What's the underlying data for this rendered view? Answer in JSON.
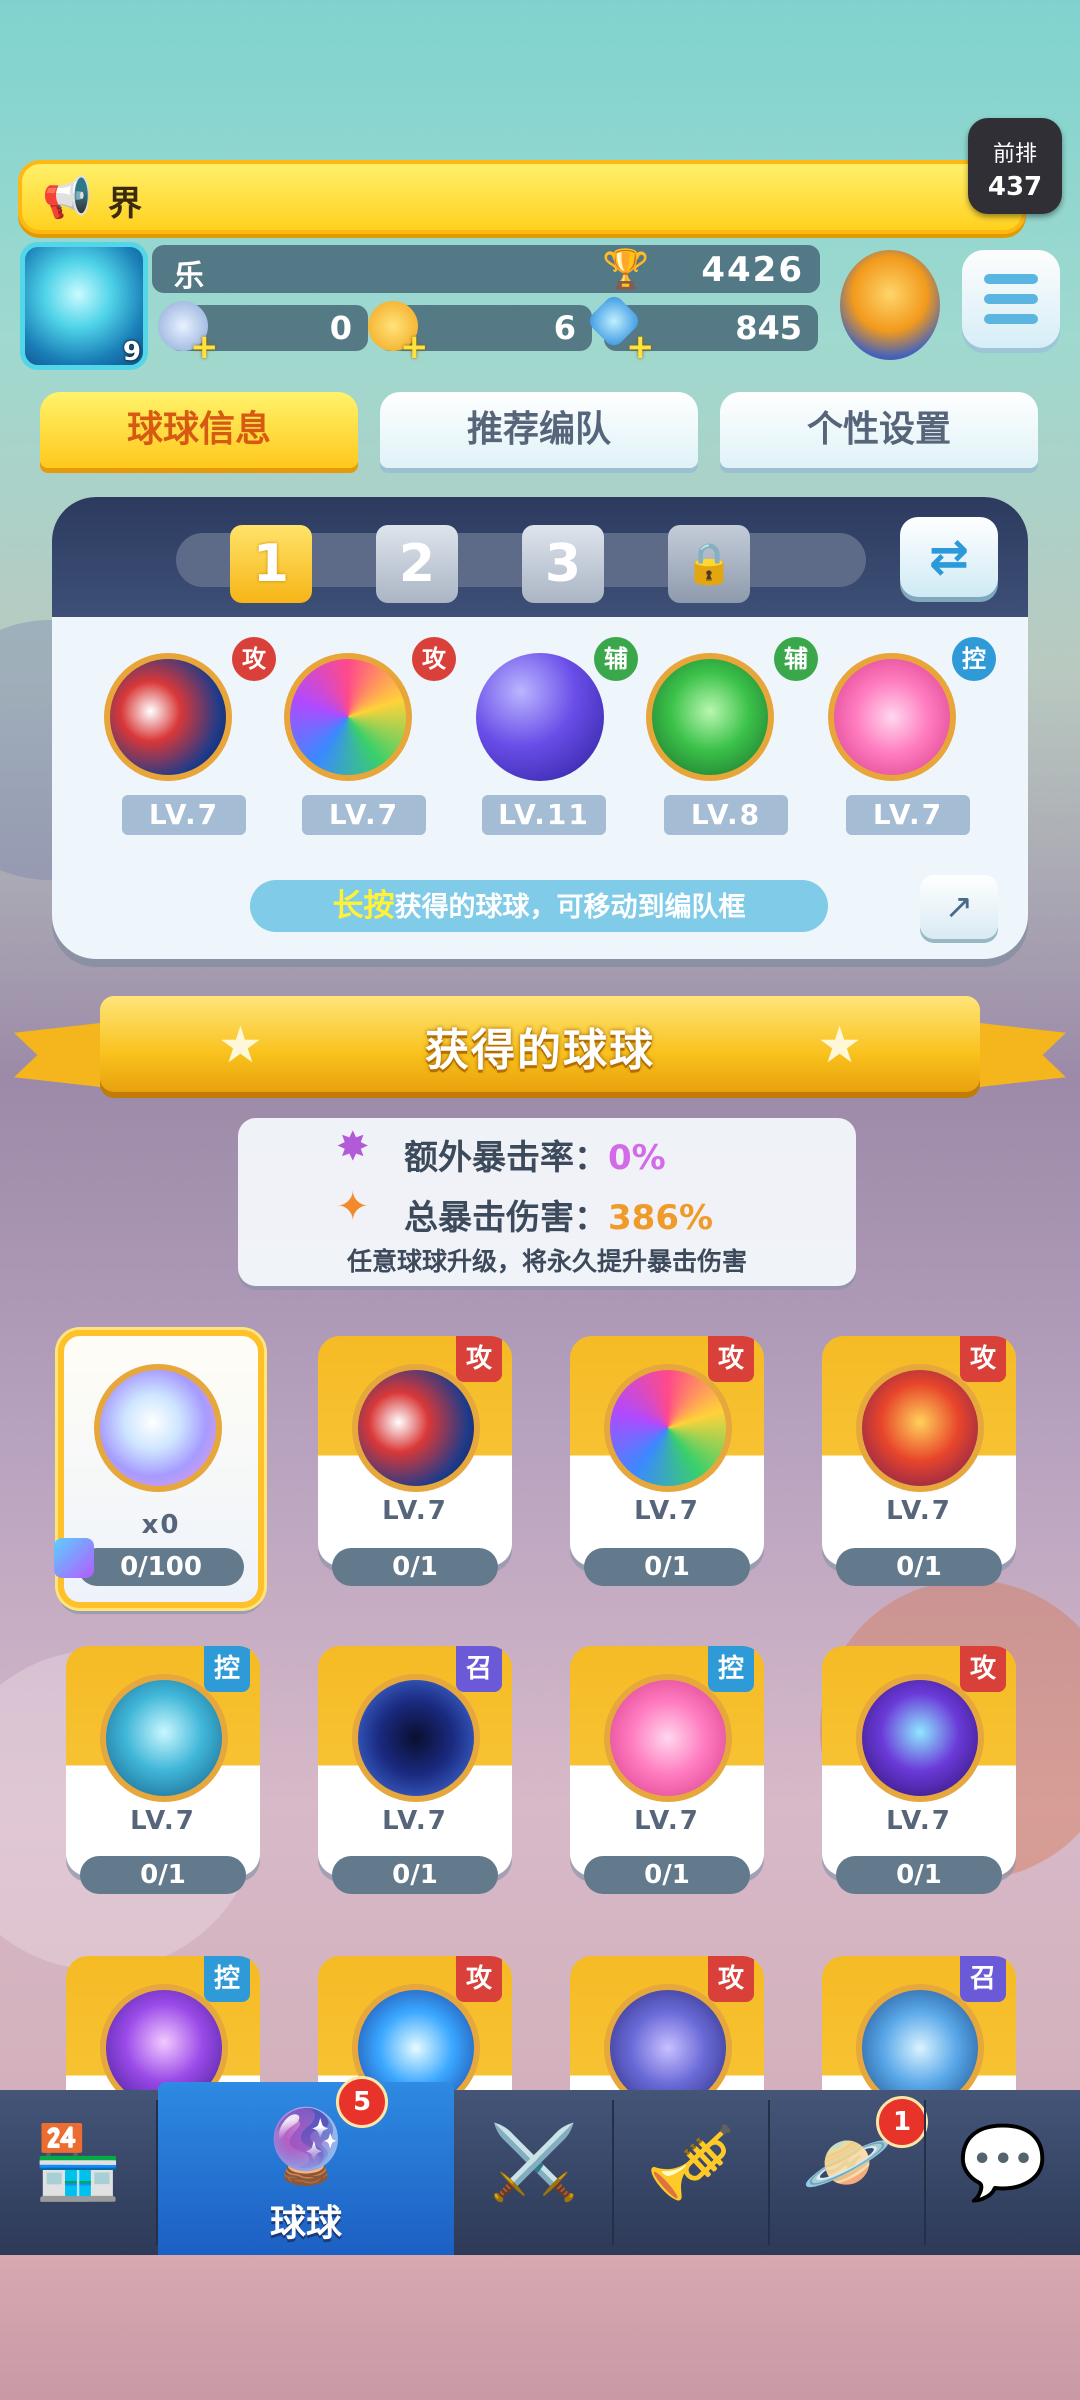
{
  "colors": {
    "gold": "#ffc81c",
    "attack": "#d9403a",
    "control": "#2f9ad8",
    "support": "#3aa84a",
    "summon": "#6b5ad8"
  },
  "announce": {
    "text": "界"
  },
  "rank": {
    "label": "前排",
    "value": "437"
  },
  "profile": {
    "name": "乐",
    "level": "9",
    "trophies": "4426",
    "coins": "0",
    "gold": "6",
    "gems": "845"
  },
  "tabs": [
    "球球信息",
    "推荐编队",
    "个性设置"
  ],
  "team": {
    "slots": [
      "1",
      "2",
      "3"
    ],
    "balls": [
      {
        "name": "opera-mask-ball",
        "tag": "攻",
        "level": "LV.7"
      },
      {
        "name": "prism-ball",
        "tag": "攻",
        "level": "LV.7"
      },
      {
        "name": "swap-ball",
        "tag": "辅",
        "level": "LV.11"
      },
      {
        "name": "arrow-ball",
        "tag": "辅",
        "level": "LV.8"
      },
      {
        "name": "heart-ball",
        "tag": "控",
        "level": "LV.7"
      }
    ],
    "hint_highlight": "长按",
    "hint_text": "获得的球球，可移动到编队框"
  },
  "collection": {
    "title": "获得的球球",
    "crit_rate_label": "额外暴击率：",
    "crit_rate_value": "0%",
    "crit_dmg_label": "总暴击伤害：",
    "crit_dmg_value": "386%",
    "note": "任意球球升级，将永久提升暴击伤害",
    "cards": [
      {
        "tag": "",
        "level": "x0",
        "progress": "0/100"
      },
      {
        "tag": "攻",
        "level": "LV.7",
        "progress": "0/1"
      },
      {
        "tag": "攻",
        "level": "LV.7",
        "progress": "0/1"
      },
      {
        "tag": "攻",
        "level": "LV.7",
        "progress": "0/1"
      },
      {
        "tag": "控",
        "level": "LV.7",
        "progress": "0/1"
      },
      {
        "tag": "召",
        "level": "LV.7",
        "progress": "0/1"
      },
      {
        "tag": "控",
        "level": "LV.7",
        "progress": "0/1"
      },
      {
        "tag": "攻",
        "level": "LV.7",
        "progress": "0/1"
      },
      {
        "tag": "控",
        "level": "",
        "progress": ""
      },
      {
        "tag": "攻",
        "level": "",
        "progress": ""
      },
      {
        "tag": "攻",
        "level": "",
        "progress": ""
      },
      {
        "tag": "召",
        "level": "",
        "progress": ""
      }
    ]
  },
  "nav": {
    "items": [
      {
        "name": "shop-icon"
      },
      {
        "name": "balls-icon",
        "label": "球球",
        "badge": "5"
      },
      {
        "name": "battle-swords-icon"
      },
      {
        "name": "whistle-icon"
      },
      {
        "name": "planet-icon",
        "badge": "1"
      },
      {
        "name": "chat-icon"
      }
    ]
  }
}
